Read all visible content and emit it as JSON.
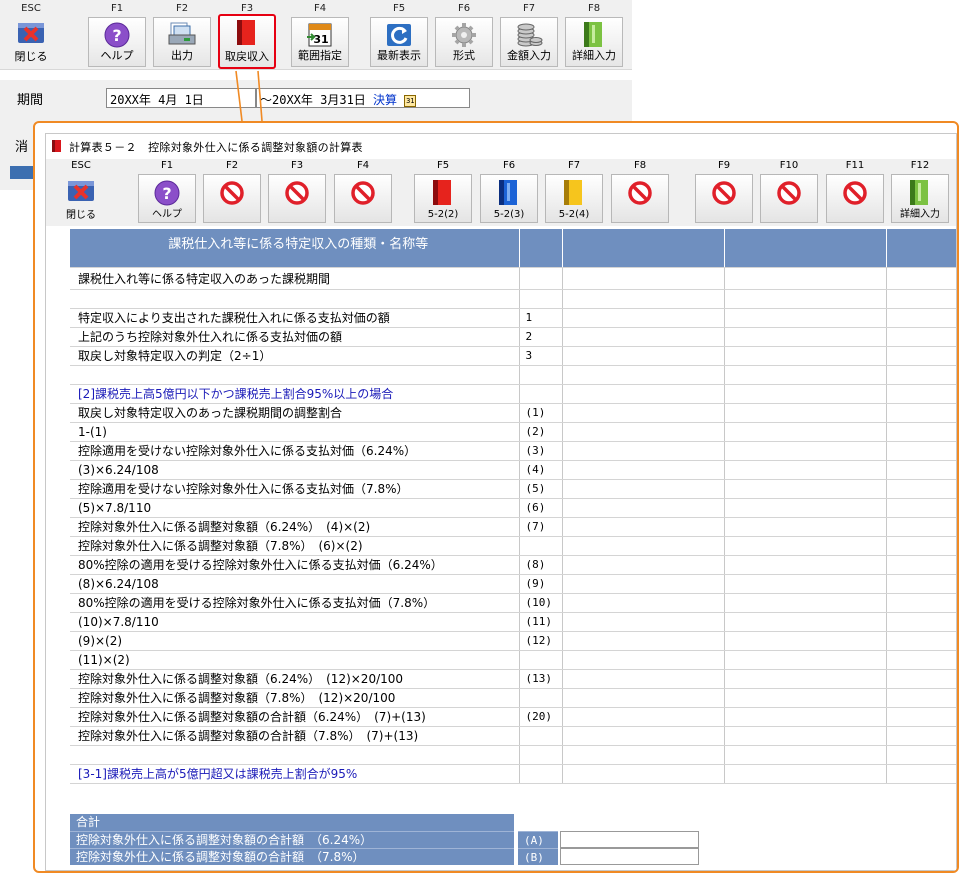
{
  "main_toolbar": {
    "buttons": [
      {
        "key": "ESC",
        "label": "閉じる",
        "icon": "close-x-icon"
      },
      {
        "key": "F1",
        "label": "ヘルプ",
        "icon": "help-icon"
      },
      {
        "key": "F2",
        "label": "出力",
        "icon": "output-icon"
      },
      {
        "key": "F3",
        "label": "取戻収入",
        "icon": "red-binder-icon"
      },
      {
        "key": "F4",
        "label": "範囲指定",
        "icon": "calendar-icon",
        "icon_text": "31"
      },
      {
        "key": "F5",
        "label": "最新表示",
        "icon": "refresh-icon"
      },
      {
        "key": "F6",
        "label": "形式",
        "icon": "gear-icon"
      },
      {
        "key": "F7",
        "label": "金額入力",
        "icon": "coins-icon"
      },
      {
        "key": "F8",
        "label": "詳細入力",
        "icon": "green-binder-icon"
      }
    ],
    "active_color": "#e60012"
  },
  "period": {
    "label": "期間",
    "start": "20XX年 4月 1日",
    "end": "～20XX年 3月31日",
    "kessan": "決算",
    "cal_glyph": "31"
  },
  "bg_label": "消",
  "popup": {
    "title": "計算表５－２　控除対象外仕入に係る調整対象額の計算表",
    "border_color": "#f08a24",
    "buttons": [
      {
        "key": "ESC",
        "label": "閉じる",
        "icon": "close-x-icon"
      },
      {
        "key": "F1",
        "label": "ヘルプ",
        "icon": "help-icon"
      },
      {
        "key": "F2",
        "label": "",
        "icon": "disabled-icon"
      },
      {
        "key": "F3",
        "label": "",
        "icon": "disabled-icon"
      },
      {
        "key": "F4",
        "label": "",
        "icon": "disabled-icon"
      },
      {
        "key": "F5",
        "label": "5-2(2)",
        "icon": "red-binder-icon"
      },
      {
        "key": "F6",
        "label": "5-2(3)",
        "icon": "blue-binder-icon"
      },
      {
        "key": "F7",
        "label": "5-2(4)",
        "icon": "yellow-binder-icon"
      },
      {
        "key": "F8",
        "label": "",
        "icon": "disabled-icon"
      },
      {
        "key": "F9",
        "label": "",
        "icon": "disabled-icon"
      },
      {
        "key": "F10",
        "label": "",
        "icon": "disabled-icon"
      },
      {
        "key": "F11",
        "label": "",
        "icon": "disabled-icon"
      },
      {
        "key": "F12",
        "label": "詳細入力",
        "icon": "green-binder-icon"
      }
    ]
  },
  "grid": {
    "header": "課税仕入れ等に係る特定収入の種類・名称等",
    "header_color": "#6f8fbf",
    "rows": [
      {
        "type": "first",
        "label": "課税仕入れ等に係る特定収入のあった課税期間",
        "num": ""
      },
      {
        "type": "spacer",
        "label": "",
        "num": ""
      },
      {
        "type": "normal",
        "label": "特定収入により支出された課税仕入れに係る支払対価の額",
        "num": "1"
      },
      {
        "type": "normal",
        "label": "上記のうち控除対象外仕入れに係る支払対価の額",
        "num": "2"
      },
      {
        "type": "normal",
        "label": "取戻し対象特定収入の判定（2÷1）",
        "num": "3"
      },
      {
        "type": "spacer",
        "label": "",
        "num": ""
      },
      {
        "type": "section",
        "label": "[2]課税売上高5億円以下かつ課税売上割合95%以上の場合",
        "num": ""
      },
      {
        "type": "normal",
        "label": "取戻し対象特定収入のあった課税期間の調整割合",
        "num": "(1)"
      },
      {
        "type": "normal",
        "label": "1-(1)",
        "num": "(2)"
      },
      {
        "type": "normal",
        "label": "控除適用を受けない控除対象外仕入に係る支払対価（6.24%）",
        "num": "(3)"
      },
      {
        "type": "normal",
        "label": "(3)×6.24/108",
        "num": "(4)"
      },
      {
        "type": "normal",
        "label": "控除適用を受けない控除対象外仕入に係る支払対価（7.8%）",
        "num": "(5)"
      },
      {
        "type": "normal",
        "label": "(5)×7.8/110",
        "num": "(6)"
      },
      {
        "type": "normal",
        "label": "控除対象外仕入に係る調整対象額（6.24%）　(4)×(2)",
        "num": "(7)"
      },
      {
        "type": "normal",
        "label": "控除対象外仕入に係る調整対象額（7.8%）　(6)×(2)",
        "num": ""
      },
      {
        "type": "normal",
        "label": "80%控除の適用を受ける控除対象外仕入に係る支払対価（6.24%）",
        "num": "(8)"
      },
      {
        "type": "normal",
        "label": "(8)×6.24/108",
        "num": "(9)"
      },
      {
        "type": "normal",
        "label": "80%控除の適用を受ける控除対象外仕入に係る支払対価（7.8%）",
        "num": "(10)"
      },
      {
        "type": "normal",
        "label": "(10)×7.8/110",
        "num": "(11)"
      },
      {
        "type": "normal",
        "label": "(9)×(2)",
        "num": "(12)"
      },
      {
        "type": "normal",
        "label": "(11)×(2)",
        "num": ""
      },
      {
        "type": "normal",
        "label": "控除対象外仕入に係る調整対象額（6.24%）　(12)×20/100",
        "num": "(13)"
      },
      {
        "type": "normal",
        "label": "控除対象外仕入に係る調整対象額（7.8%）　(12)×20/100",
        "num": ""
      },
      {
        "type": "normal",
        "label": "控除対象外仕入に係る調整対象額の合計額（6.24%）　(7)+(13)",
        "num": "(20)"
      },
      {
        "type": "normal",
        "label": "控除対象外仕入に係る調整対象額の合計額（7.8%）　(7)+(13)",
        "num": ""
      },
      {
        "type": "spacer",
        "label": "",
        "num": ""
      },
      {
        "type": "section",
        "label": "[3-1]課税売上高が5億円超又は課税売上割合が95%",
        "num": ""
      }
    ]
  },
  "totals": {
    "header": "合計",
    "rows": [
      {
        "label": "控除対象外仕入に係る調整対象額の合計額　（6.24%）",
        "code": "(A)",
        "value": ""
      },
      {
        "label": "控除対象外仕入に係る調整対象額の合計額　（7.8%）",
        "code": "(B)",
        "value": ""
      }
    ]
  }
}
